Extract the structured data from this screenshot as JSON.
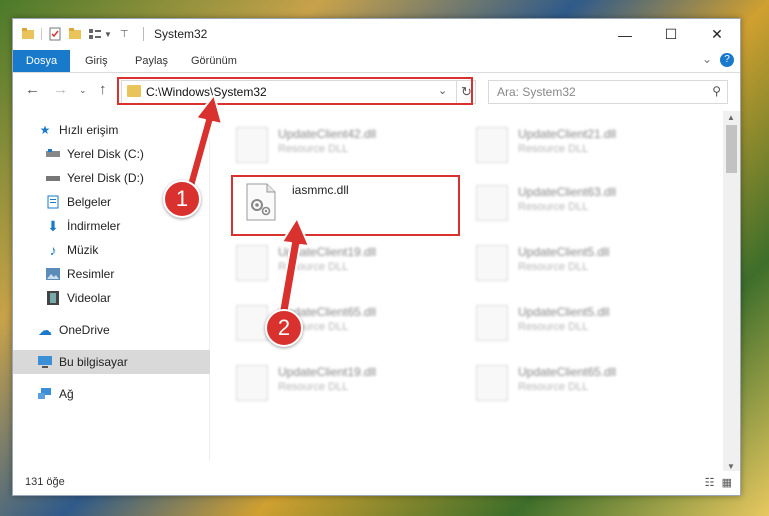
{
  "window": {
    "title": "System32",
    "minimize_glyph": "—",
    "maximize_glyph": "☐",
    "close_glyph": "✕"
  },
  "ribbon": {
    "tabs": [
      {
        "label": "Dosya",
        "active": true
      },
      {
        "label": "Giriş",
        "active": false
      },
      {
        "label": "Paylaş",
        "active": false
      },
      {
        "label": "Görünüm",
        "active": false
      }
    ],
    "help_label": "?"
  },
  "address": {
    "path": "C:\\Windows\\System32",
    "search_placeholder": "Ara: System32"
  },
  "sidebar": {
    "items": [
      {
        "label": "Hızlı erişim",
        "icon": "star-icon"
      },
      {
        "label": "Yerel Disk (C:)",
        "icon": "drive-icon"
      },
      {
        "label": "Yerel Disk (D:)",
        "icon": "drive-icon"
      },
      {
        "label": "Belgeler",
        "icon": "documents-icon"
      },
      {
        "label": "İndirmeler",
        "icon": "download-icon"
      },
      {
        "label": "Müzik",
        "icon": "music-icon"
      },
      {
        "label": "Resimler",
        "icon": "pictures-icon"
      },
      {
        "label": "Videolar",
        "icon": "video-icon"
      },
      {
        "label": "OneDrive",
        "icon": "cloud-icon"
      },
      {
        "label": "Bu bilgisayar",
        "icon": "computer-icon"
      },
      {
        "label": "Ağ",
        "icon": "network-icon"
      }
    ]
  },
  "files": {
    "highlighted": {
      "name": "iasmmc.dll"
    },
    "blurred": [
      {
        "name": "UpdateClient42.dll",
        "desc": "Resource DLL"
      },
      {
        "name": "UpdateClient21.dll",
        "desc": "Resource DLL"
      },
      {
        "name": "UpdateClient63.dll",
        "desc": "Resource DLL"
      },
      {
        "name": "UpdateClient19.dll",
        "desc": "Resource DLL"
      },
      {
        "name": "UpdateClient5.dll",
        "desc": "Resource DLL"
      },
      {
        "name": "UpdateClient65.dll",
        "desc": "Resource DLL"
      },
      {
        "name": "UpdateClient5.dll",
        "desc": "Resource DLL"
      },
      {
        "name": "UpdateClient19.dll",
        "desc": "Resource DLL"
      },
      {
        "name": "UpdateClient65.dll",
        "desc": "Resource DLL"
      }
    ]
  },
  "status": {
    "count": "131 öğe"
  },
  "annotations": {
    "step1": "1",
    "step2": "2",
    "color": "#d9322e"
  },
  "colors": {
    "accent": "#1979ca",
    "selection": "#d9d9d9"
  }
}
